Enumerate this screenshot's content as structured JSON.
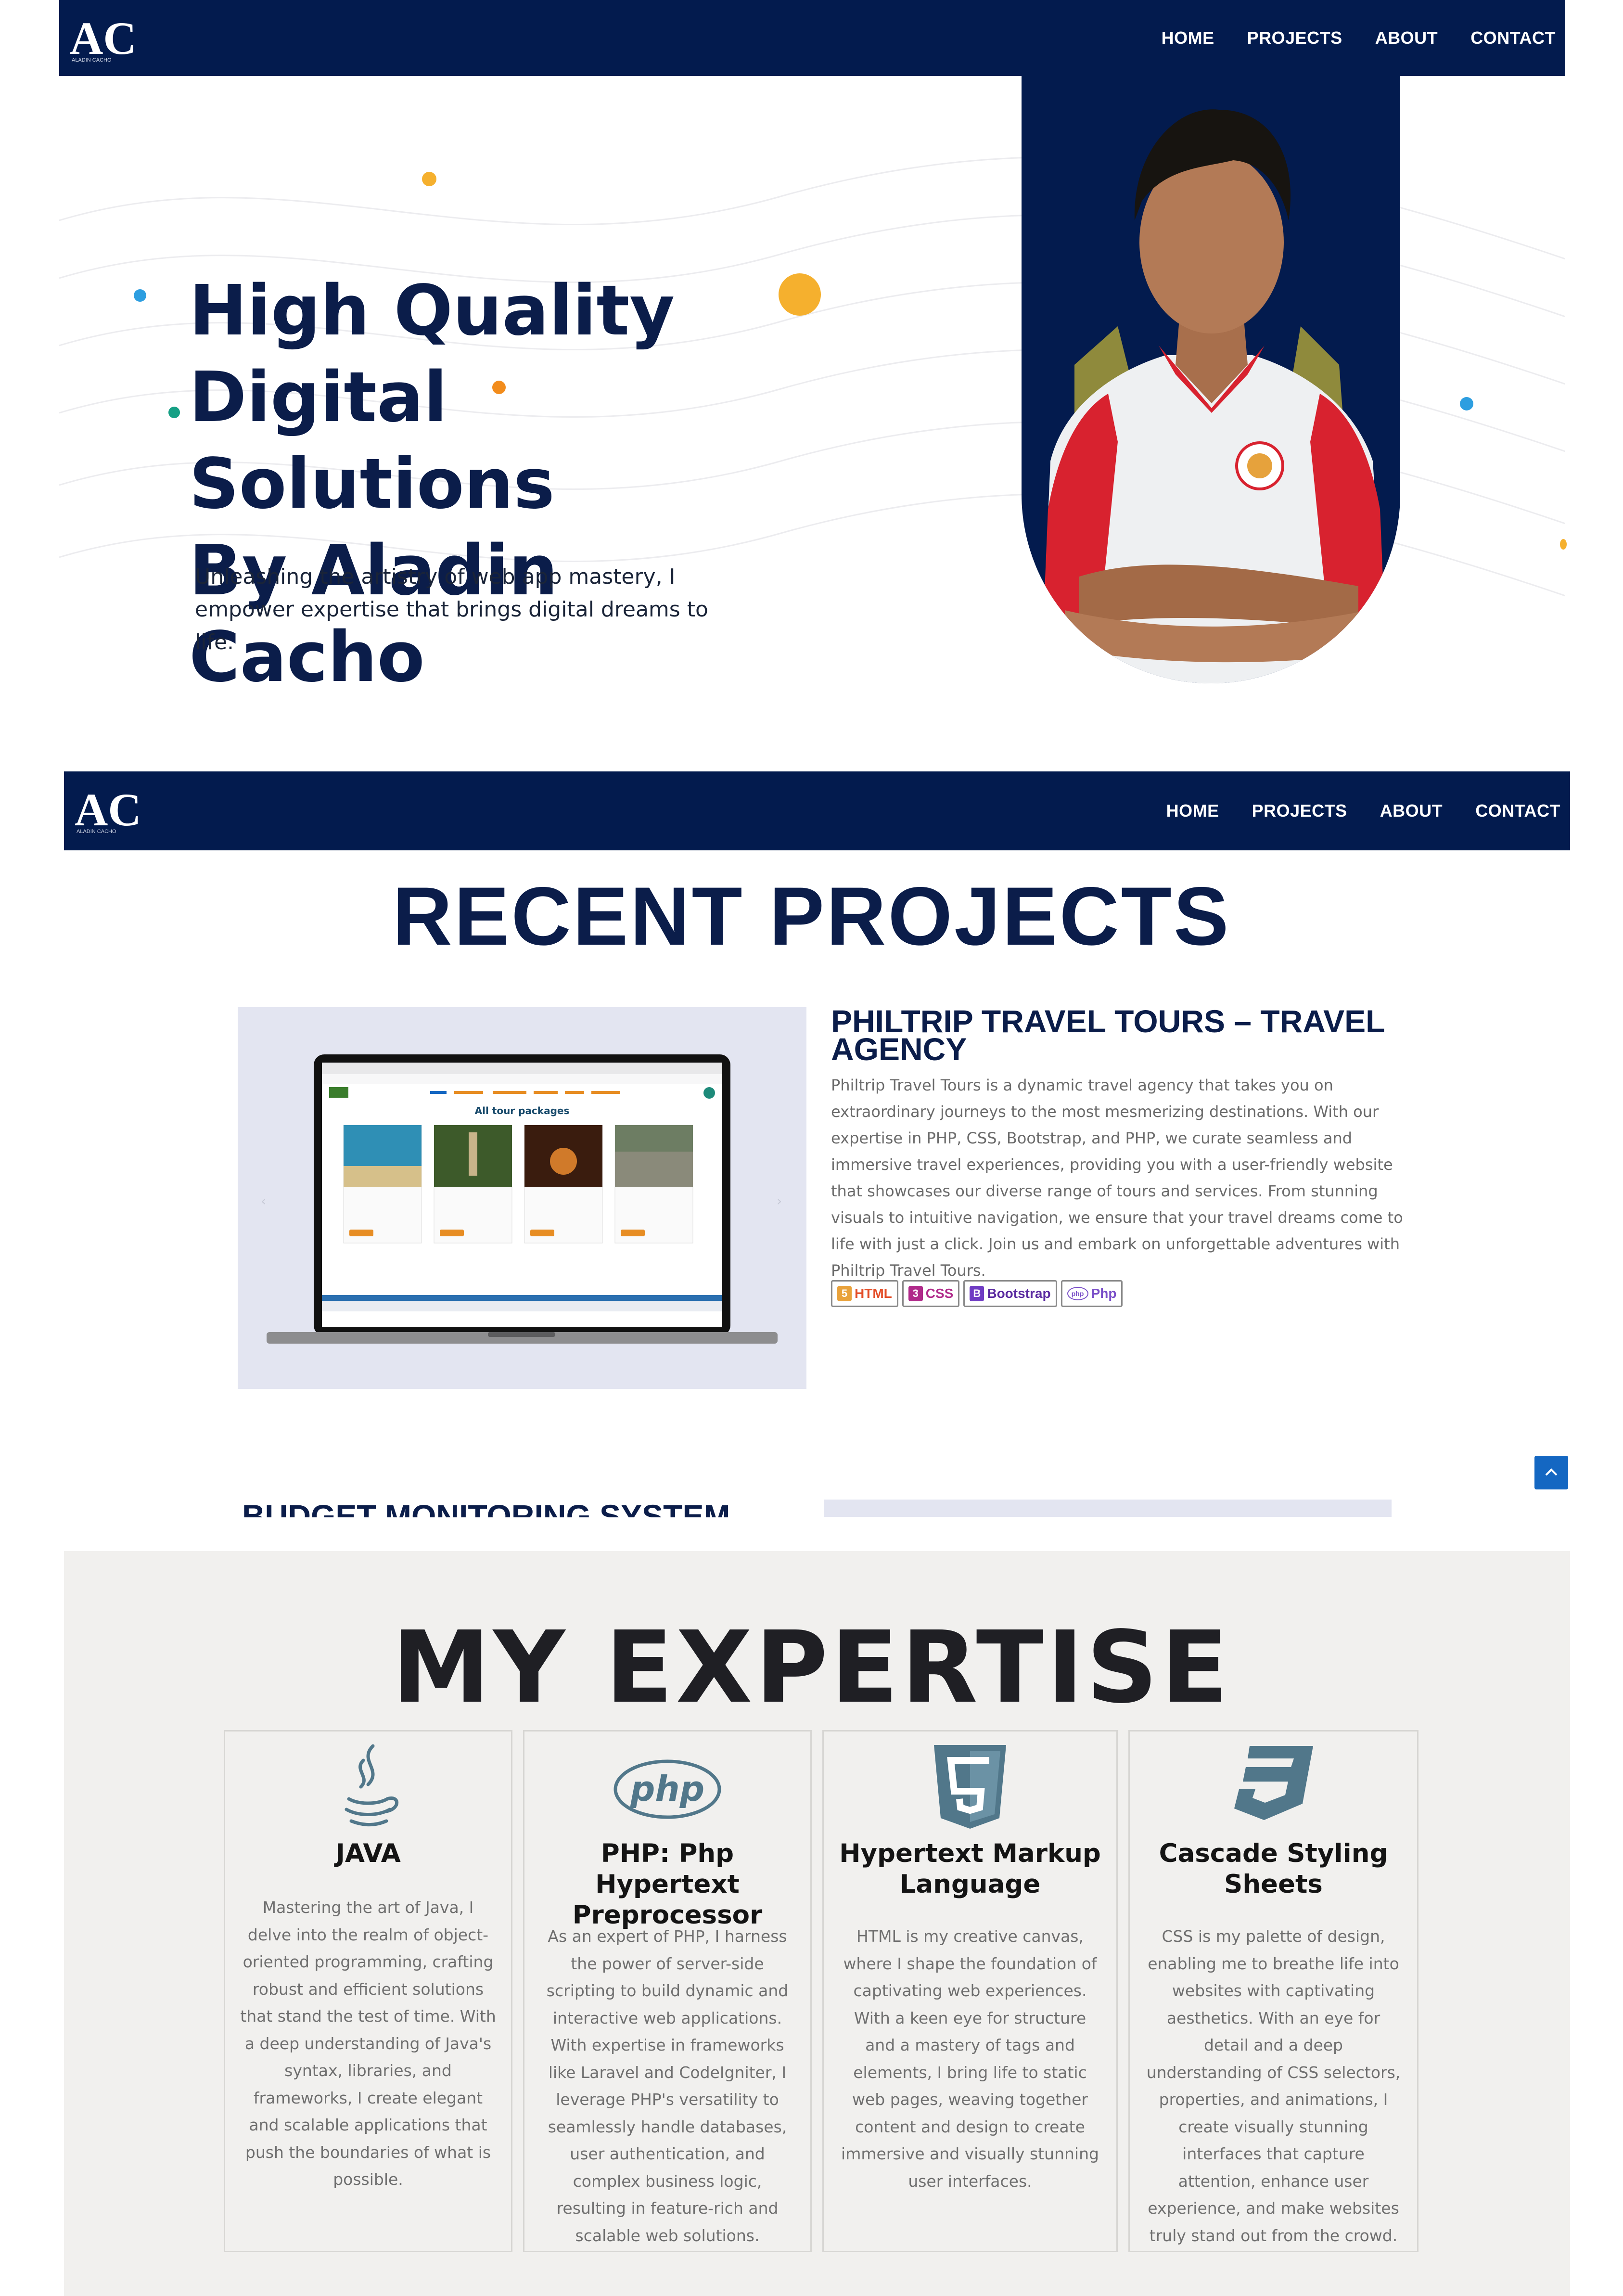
{
  "nav": {
    "logo_text": "AC",
    "logo_caption": "ALADIN CACHO",
    "items": [
      "HOME",
      "PROJECTS",
      "ABOUT",
      "CONTACT"
    ]
  },
  "hero": {
    "title_lines": [
      "High Quality",
      "Digital Solutions",
      "By Aladin Cacho"
    ],
    "subtitle": "Unleashing the artistry of web app mastery, I empower expertise that brings digital dreams to life."
  },
  "projects": {
    "heading": "RECENT PROJECTS",
    "items": [
      {
        "title": "PHILTRIP TRAVEL TOURS – TRAVEL AGENCY",
        "description": "Philtrip Travel Tours is a dynamic travel agency that takes you on extraordinary journeys to the most mesmerizing destinations. With our expertise in PHP, CSS, Bootstrap, and PHP, we curate seamless and immersive travel experiences, providing you with a user-friendly website that showcases our diverse range of tours and services. From stunning visuals to intuitive navigation, we ensure that your travel dreams come to life with just a click. Join us and embark on unforgettable adventures with Philtrip Travel Tours.",
        "screen_heading": "All tour packages",
        "tags": [
          "HTML",
          "CSS",
          "Bootstrap",
          "Php"
        ]
      },
      {
        "title": "BUDGET MONITORING SYSTEM OF"
      }
    ]
  },
  "expertise": {
    "heading": "MY EXPERTISE",
    "cards": [
      {
        "icon": "java-icon",
        "title": "JAVA",
        "text": "Mastering the art of Java, I delve into the realm of object-oriented programming, crafting robust and efficient solutions that stand the test of time. With a deep understanding of Java's syntax, libraries, and frameworks, I create elegant and scalable applications that push the boundaries of what is possible."
      },
      {
        "icon": "php-icon",
        "icon_text": "php",
        "title": "PHP: Php Hypertext Preprocessor",
        "text": "As an expert of PHP, I harness the power of server-side scripting to build dynamic and interactive web applications. With expertise in frameworks like Laravel and CodeIgniter, I leverage PHP's versatility to seamlessly handle databases, user authentication, and complex business logic, resulting in feature-rich and scalable web solutions."
      },
      {
        "icon": "html5-icon",
        "title": "Hypertext Markup Language",
        "text": "HTML is my creative canvas, where I shape the foundation of captivating web experiences. With a keen eye for structure and a mastery of tags and elements, I bring life to static web pages, weaving together content and design to create immersive and visually stunning user interfaces."
      },
      {
        "icon": "css3-icon",
        "title": "Cascade Styling Sheets",
        "text": "CSS is my palette of design, enabling me to breathe life into websites with captivating aesthetics. With an eye for detail and a deep understanding of CSS selectors, properties, and animations, I create visually stunning interfaces that capture attention, enhance user experience, and make websites truly stand out from the crowd."
      }
    ]
  },
  "colors": {
    "navy": "#031b4e",
    "accent_orange": "#f5b02e",
    "accent_blue": "#2d9ee0",
    "accent_teal": "#16a085"
  }
}
